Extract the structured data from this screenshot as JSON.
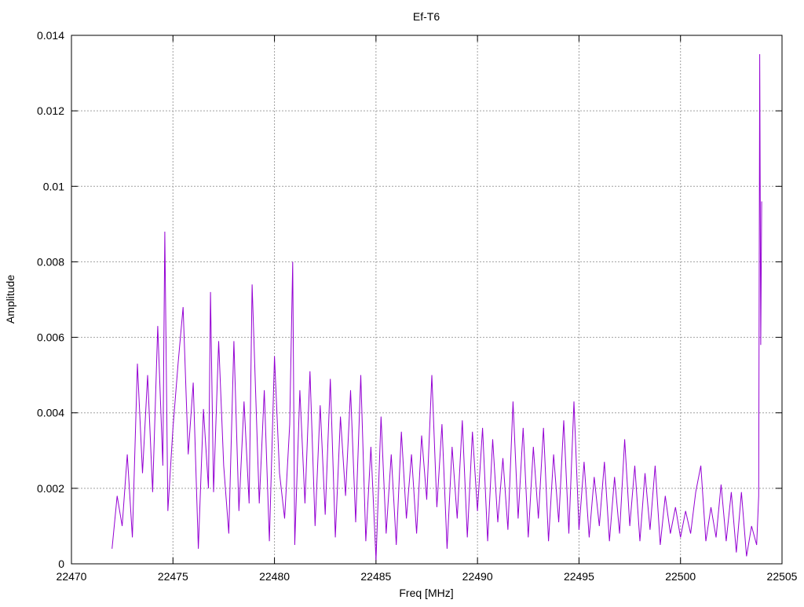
{
  "chart_data": {
    "type": "line",
    "title": "Ef-T6",
    "xlabel": "Freq [MHz]",
    "ylabel": "Amplitude",
    "xlim": [
      22470,
      22505
    ],
    "ylim": [
      0,
      0.014
    ],
    "xticks": [
      "22470",
      "22475",
      "22480",
      "22485",
      "22490",
      "22495",
      "22500",
      "22505"
    ],
    "xtick_values": [
      22470,
      22475,
      22480,
      22485,
      22490,
      22495,
      22500,
      22505
    ],
    "yticks": [
      "0",
      "0.002",
      "0.004",
      "0.006",
      "0.008",
      "0.01",
      "0.012",
      "0.014"
    ],
    "ytick_values": [
      0,
      0.002,
      0.004,
      0.006,
      0.008,
      0.01,
      0.012,
      0.014
    ],
    "grid": true,
    "legend": "none",
    "series": [
      {
        "name": "Ef-T6",
        "color": "#9400d3",
        "points": [
          [
            22472.0,
            0.0004
          ],
          [
            22472.25,
            0.0018
          ],
          [
            22472.5,
            0.001
          ],
          [
            22472.75,
            0.0029
          ],
          [
            22473.0,
            0.0007
          ],
          [
            22473.25,
            0.0053
          ],
          [
            22473.5,
            0.0024
          ],
          [
            22473.75,
            0.005
          ],
          [
            22474.0,
            0.0019
          ],
          [
            22474.25,
            0.0063
          ],
          [
            22474.5,
            0.0026
          ],
          [
            22474.6,
            0.0088
          ],
          [
            22474.75,
            0.0014
          ],
          [
            22475.0,
            0.0036
          ],
          [
            22475.25,
            0.0053
          ],
          [
            22475.5,
            0.0068
          ],
          [
            22475.75,
            0.0029
          ],
          [
            22476.0,
            0.0048
          ],
          [
            22476.25,
            0.0004
          ],
          [
            22476.5,
            0.0041
          ],
          [
            22476.75,
            0.002
          ],
          [
            22476.85,
            0.0072
          ],
          [
            22477.0,
            0.0019
          ],
          [
            22477.25,
            0.0059
          ],
          [
            22477.5,
            0.0026
          ],
          [
            22477.75,
            0.0008
          ],
          [
            22478.0,
            0.0059
          ],
          [
            22478.25,
            0.0014
          ],
          [
            22478.5,
            0.0043
          ],
          [
            22478.75,
            0.0016
          ],
          [
            22478.9,
            0.0074
          ],
          [
            22479.25,
            0.0016
          ],
          [
            22479.5,
            0.0046
          ],
          [
            22479.75,
            0.0006
          ],
          [
            22480.0,
            0.0055
          ],
          [
            22480.25,
            0.0024
          ],
          [
            22480.5,
            0.0012
          ],
          [
            22480.75,
            0.0037
          ],
          [
            22480.9,
            0.008
          ],
          [
            22481.0,
            0.0005
          ],
          [
            22481.25,
            0.0046
          ],
          [
            22481.5,
            0.0016
          ],
          [
            22481.75,
            0.0051
          ],
          [
            22482.0,
            0.001
          ],
          [
            22482.25,
            0.0042
          ],
          [
            22482.5,
            0.0013
          ],
          [
            22482.75,
            0.0049
          ],
          [
            22483.0,
            0.0007
          ],
          [
            22483.25,
            0.0039
          ],
          [
            22483.5,
            0.0018
          ],
          [
            22483.75,
            0.0046
          ],
          [
            22484.0,
            0.0011
          ],
          [
            22484.25,
            0.005
          ],
          [
            22484.5,
            0.0006
          ],
          [
            22484.75,
            0.0031
          ],
          [
            22485.0,
            0.0001
          ],
          [
            22485.25,
            0.0039
          ],
          [
            22485.5,
            0.0008
          ],
          [
            22485.75,
            0.0029
          ],
          [
            22486.0,
            0.0005
          ],
          [
            22486.25,
            0.0035
          ],
          [
            22486.5,
            0.0012
          ],
          [
            22486.75,
            0.0029
          ],
          [
            22487.0,
            0.0008
          ],
          [
            22487.25,
            0.0034
          ],
          [
            22487.5,
            0.0017
          ],
          [
            22487.75,
            0.005
          ],
          [
            22488.0,
            0.0015
          ],
          [
            22488.25,
            0.0037
          ],
          [
            22488.5,
            0.0004
          ],
          [
            22488.75,
            0.0031
          ],
          [
            22489.0,
            0.0012
          ],
          [
            22489.25,
            0.0038
          ],
          [
            22489.5,
            0.0007
          ],
          [
            22489.75,
            0.0035
          ],
          [
            22490.0,
            0.0014
          ],
          [
            22490.25,
            0.0036
          ],
          [
            22490.5,
            0.0006
          ],
          [
            22490.75,
            0.0033
          ],
          [
            22491.0,
            0.0011
          ],
          [
            22491.25,
            0.0028
          ],
          [
            22491.5,
            0.0009
          ],
          [
            22491.75,
            0.0043
          ],
          [
            22492.0,
            0.0012
          ],
          [
            22492.25,
            0.0036
          ],
          [
            22492.5,
            0.0007
          ],
          [
            22492.75,
            0.0031
          ],
          [
            22493.0,
            0.0012
          ],
          [
            22493.25,
            0.0036
          ],
          [
            22493.5,
            0.0006
          ],
          [
            22493.75,
            0.0029
          ],
          [
            22494.0,
            0.0011
          ],
          [
            22494.25,
            0.0038
          ],
          [
            22494.5,
            0.0008
          ],
          [
            22494.75,
            0.0043
          ],
          [
            22495.0,
            0.0009
          ],
          [
            22495.25,
            0.0027
          ],
          [
            22495.5,
            0.0007
          ],
          [
            22495.75,
            0.0023
          ],
          [
            22496.0,
            0.001
          ],
          [
            22496.25,
            0.0027
          ],
          [
            22496.5,
            0.0006
          ],
          [
            22496.75,
            0.0023
          ],
          [
            22497.0,
            0.0008
          ],
          [
            22497.25,
            0.0033
          ],
          [
            22497.5,
            0.001
          ],
          [
            22497.75,
            0.0026
          ],
          [
            22498.0,
            0.0006
          ],
          [
            22498.25,
            0.0024
          ],
          [
            22498.5,
            0.0009
          ],
          [
            22498.75,
            0.0026
          ],
          [
            22499.0,
            0.0005
          ],
          [
            22499.25,
            0.0018
          ],
          [
            22499.5,
            0.0008
          ],
          [
            22499.75,
            0.0015
          ],
          [
            22500.0,
            0.0007
          ],
          [
            22500.25,
            0.0014
          ],
          [
            22500.5,
            0.0008
          ],
          [
            22500.75,
            0.0019
          ],
          [
            22501.0,
            0.0026
          ],
          [
            22501.25,
            0.0006
          ],
          [
            22501.5,
            0.0015
          ],
          [
            22501.75,
            0.0007
          ],
          [
            22502.0,
            0.0021
          ],
          [
            22502.25,
            0.0006
          ],
          [
            22502.5,
            0.0019
          ],
          [
            22502.75,
            0.0003
          ],
          [
            22503.0,
            0.0019
          ],
          [
            22503.25,
            0.0002
          ],
          [
            22503.5,
            0.001
          ],
          [
            22503.75,
            0.0005
          ],
          [
            22503.85,
            0.0018
          ],
          [
            22503.9,
            0.0135
          ],
          [
            22503.95,
            0.0058
          ],
          [
            22504.0,
            0.0096
          ]
        ]
      }
    ]
  }
}
